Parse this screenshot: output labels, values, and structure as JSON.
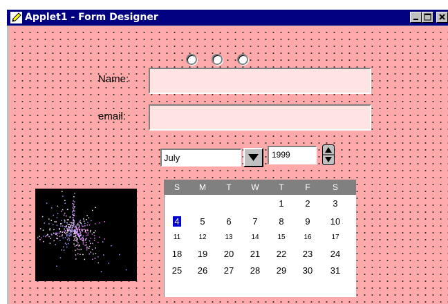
{
  "window": {
    "title": "Applet1 - Form Designer",
    "titlebar_color": "#000080",
    "canvas_color": "#ffaaaa"
  },
  "form": {
    "radio_count": 3,
    "name_label": "Name:",
    "email_label": "email:",
    "name_value": "",
    "email_value": ""
  },
  "date_picker": {
    "month": "July",
    "year": "1999",
    "weekdays": [
      "S",
      "M",
      "T",
      "W",
      "T",
      "F",
      "S"
    ],
    "weeks": [
      [
        "",
        "",
        "",
        "",
        "1",
        "2",
        "3"
      ],
      [
        "4",
        "5",
        "6",
        "7",
        "8",
        "9",
        "10"
      ],
      [
        "11",
        "12",
        "13",
        "14",
        "15",
        "16",
        "17"
      ],
      [
        "18",
        "19",
        "20",
        "21",
        "22",
        "23",
        "24"
      ],
      [
        "25",
        "26",
        "27",
        "28",
        "29",
        "30",
        "31"
      ]
    ],
    "selected_day": "4",
    "header_color": "#808080",
    "selection_color": "#0000cc"
  },
  "icons": {
    "title_icon": "pencil-icon",
    "minimize": "minimize-icon",
    "maximize": "maximize-icon",
    "close": "close-icon",
    "dropdown": "triangle-down-icon",
    "spinner": "spinner-arrows-icon",
    "image": "fireworks-image"
  }
}
